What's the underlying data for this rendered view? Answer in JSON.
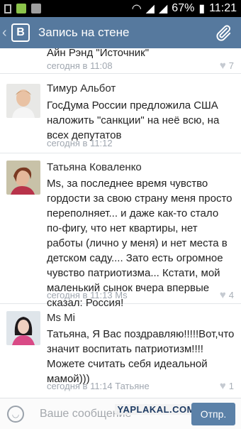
{
  "status_bar": {
    "battery": "67%",
    "time": "11:21"
  },
  "app_bar": {
    "logo": "B",
    "title": "Запись на стене",
    "back_icon": "chevron-left-icon",
    "attach_icon": "paperclip-icon"
  },
  "colors": {
    "app_bar": "#56799e",
    "send_button": "#5b81a8",
    "meta_text": "#a0a7b0"
  },
  "comments": [
    {
      "author": "",
      "text": "Айн Рэнд \"Источник\"",
      "time": "сегодня в 11:08",
      "likes": "7"
    },
    {
      "author": "Тимур Альбот",
      "text": "ГосДума России предложила США наложить \"санкции\" на неё всю, на всех депутатов",
      "time": "сегодня в 11:12",
      "likes": ""
    },
    {
      "author": "Татьяна Коваленко",
      "text": "Ms, за последнее время чувство гордости за свою страну меня просто переполняет... и даже как-то стало по-фигу, что нет квартиры, нет работы (лично у меня) и нет места в детском саду.... Зато есть огромное чувство патриотизма... Кстати, мой маленький сынок вчера впервые сказал: Россия!",
      "time": "сегодня в 11:13 Ms",
      "likes": "4"
    },
    {
      "author": "Ms Mi",
      "text": "Татьяна, Я Вас поздравляю!!!!!Вот,что значит воспитать патриотизм!!!!Можете считать себя идеальной мамой)))",
      "time": "сегодня в 11:14 Татьяне",
      "likes": "1"
    }
  ],
  "composer": {
    "placeholder": "Ваше сообщение",
    "send_label": "Отпр.",
    "watermark": "YAPLAKAL.COM"
  }
}
